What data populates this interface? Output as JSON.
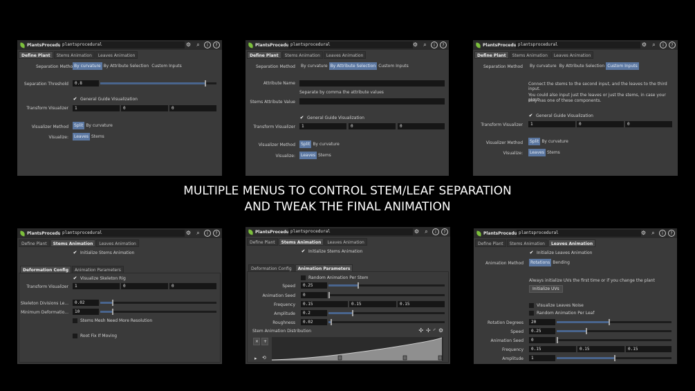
{
  "headline": {
    "line1": "MULTIPLE MENUS TO CONTROL STEM/LEAF SEPARATION",
    "line2": "AND TWEAK THE FINAL ANIMATION"
  },
  "common": {
    "node_type": "PlantsProcedural",
    "node_name": "plantsprocedural",
    "tabs": [
      "Define Plant",
      "Stems Animation",
      "Leaves Animation"
    ],
    "gear_glyph": "⚙",
    "search_glyph": "🔍",
    "info_glyph": "i",
    "help_glyph": "?",
    "icons": [
      "gear-icon",
      "search-icon",
      "info-icon",
      "help-icon"
    ]
  },
  "colors": {
    "active_blue": "#5b77a1",
    "slider_fill": "#49658e",
    "leaf_green": "#7cbf3c"
  },
  "p1": {
    "sep_label": "Separation Method",
    "sep_options": [
      "By curvature",
      "By Attribute Selection",
      "Custom Inputs"
    ],
    "sep_selected": 0,
    "thresh_label": "Separation Threshold",
    "thresh_value": "0.8",
    "thresh_level": 0.9,
    "guide_label": "General Guide Visualization",
    "tv_label": "Transform Visualizer",
    "tv_values": [
      "1",
      "0",
      "0"
    ],
    "vm_label": "Visualizer Method",
    "vm_options": [
      "Split",
      "By curvature"
    ],
    "vis_label": "Visualize:",
    "vis_options": [
      "Leaves",
      "Stems"
    ]
  },
  "p2": {
    "sep_label": "Separation Method",
    "sep_options": [
      "By curvature",
      "By Attribute Selection",
      "Custom Inputs"
    ],
    "attr_label": "Attribute Name",
    "attr_hint": "Separate by comma the attribute values",
    "stems_attr_label": "Stems Attribute Value",
    "guide_label": "General Guide Visualization",
    "tv_label": "Transform Visualizer",
    "tv_values": [
      "1",
      "0",
      "0"
    ],
    "vm_label": "Visualizer Method",
    "vm_options": [
      "Split",
      "By curvature"
    ],
    "vis_label": "Visualize:",
    "vis_options": [
      "Leaves",
      "Stems"
    ]
  },
  "p3": {
    "sep_label": "Separation Method",
    "sep_options": [
      "By curvature",
      "By Attribute Selection",
      "Custom Inputs"
    ],
    "info1": "Connect the stems to the second input, and the leaves to the third input.",
    "info2": "You could also input just the leaves or just the stems, in case your plant",
    "info3": "only has one of these components.",
    "guide_label": "General Guide Visualization",
    "tv_label": "Transform Visualizer",
    "tv_values": [
      "1",
      "0",
      "0"
    ],
    "vm_label": "Visualizer Method",
    "vm_options": [
      "Split",
      "By curvature"
    ],
    "vis_label": "Visualize:",
    "vis_options": [
      "Leaves",
      "Stems"
    ]
  },
  "p4": {
    "init_label": "Initialize Stems Animation",
    "subtabs": [
      "Deformation Config",
      "Animation Parameters"
    ],
    "skel_label": "Visualize Skeleton Rig",
    "tv_label": "Transform Visualizer",
    "tv_values": [
      "1",
      "0",
      "0"
    ],
    "div_label": "Skeleton Divisions Le...",
    "div_value": "0.02",
    "div_level": 0.1,
    "mindef_label": "Minimum Deformatio...",
    "mindef_value": "10",
    "mindef_level": 0.1,
    "mesh_label": "Stems Mesh Need More Resolution",
    "root_label": "Root Fix If Moving"
  },
  "p5": {
    "init_label": "Initialize Stems Animation",
    "subtabs": [
      "Deformation Config",
      "Animation Parameters"
    ],
    "random_label": "Random Animation Per Stem",
    "speed_label": "Speed",
    "speed_value": "0.25",
    "speed_level": 0.25,
    "seed_label": "Animation Seed",
    "seed_value": "0",
    "seed_level": 0.0,
    "freq_label": "Frequency",
    "freq_values": [
      "0.15",
      "0.15",
      "0.15"
    ],
    "amp_label": "Amplitude",
    "amp_value": "0.2",
    "amp_level": 0.2,
    "rough_label": "Roughness",
    "rough_value": "0.02",
    "rough_level": 0.02,
    "dist_label": "Stem Animation Distribution",
    "ramp_icons": [
      "move-icon",
      "add-point-icon",
      "curve-icon",
      "ramp-gear-icon"
    ],
    "ramp_glyphs": [
      "✣",
      "✢",
      "◜",
      "⚙"
    ],
    "ramp_buttons": [
      "×",
      "+"
    ],
    "play_glyphs": [
      "▸",
      "⟲"
    ]
  },
  "p6": {
    "init_label": "Initialize Leaves Animation",
    "am_label": "Animation Method",
    "am_options": [
      "Rotations",
      "Bending"
    ],
    "uv_note": "Always initialize UVs the first time  or if you change the plant",
    "uv_button": "Initialize UVs",
    "noise_label": "Visualize Leaves Noise",
    "random_label": "Random Animation Per Leaf",
    "rot_label": "Rotation Degrees",
    "rot_value": "20",
    "rot_level": 0.45,
    "speed_label": "Speed",
    "speed_value": "0.25",
    "speed_level": 0.25,
    "seed_label": "Animation Seed",
    "seed_value": "0",
    "seed_level": 0.0,
    "freq_label": "Frequency",
    "freq_values": [
      "0.15",
      "0.15",
      "0.15"
    ],
    "amp_label": "Amplitude",
    "amp_value": "1",
    "amp_level": 0.5
  }
}
